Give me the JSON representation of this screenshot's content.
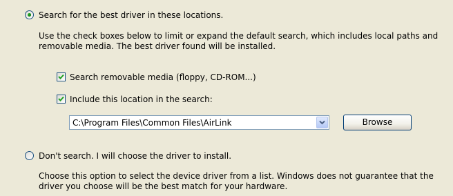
{
  "option_search": {
    "radio_selected": true,
    "label": "Search for the best driver in these locations.",
    "description": "Use the check boxes below to limit or expand the default search, which includes local paths and removable media. The best driver found will be installed."
  },
  "check_removable": {
    "checked": true,
    "label": "Search removable media (floppy, CD-ROM...)"
  },
  "check_location": {
    "checked": true,
    "label": "Include this location in the search:"
  },
  "location_combo": {
    "value": "C:\\Program Files\\Common Files\\AirLink"
  },
  "browse_button": {
    "label": "Browse"
  },
  "option_dont_search": {
    "radio_selected": false,
    "label": "Don't search. I will choose the driver to install.",
    "description": "Choose this option to select the device driver from a list.  Windows does not guarantee that the driver you choose will be the best match for your hardware."
  },
  "colors": {
    "background": "#ECE9D8",
    "radio_dot": "#21A121",
    "checkmark": "#21A121",
    "control_border": "#1C5180"
  },
  "icons": {
    "radio": "radio-button",
    "checkbox": "checkmark-icon",
    "dropdown": "chevron-down-icon"
  }
}
